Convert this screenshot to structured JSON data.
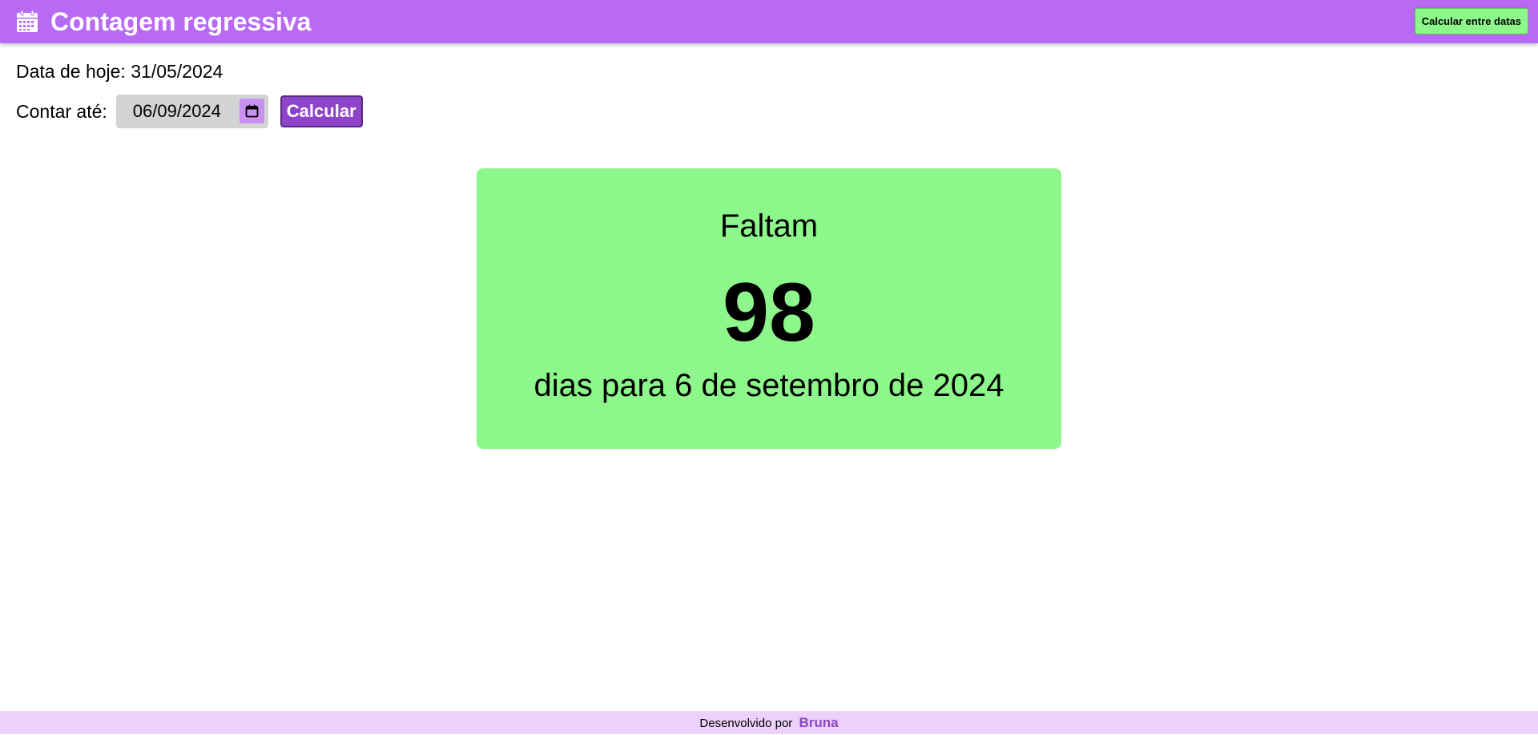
{
  "header": {
    "title": "Contagem regressiva",
    "icon": "calendar-icon",
    "between_dates_label": "Calcular entre datas"
  },
  "today": {
    "label": "Data de hoje:",
    "value": "31/05/2024"
  },
  "countdown": {
    "label": "Contar até:",
    "date_value": "06/09/2024",
    "picker_icon": "calendar-picker-icon",
    "calculate_label": "Calcular"
  },
  "result": {
    "prefix": "Faltam",
    "days": "98",
    "suffix": "dias para 6 de setembro de 2024"
  },
  "footer": {
    "text": "Desenvolvido por",
    "author": "Bruna"
  },
  "colors": {
    "header_bg": "#b86af5",
    "accent_green": "#8ef78b",
    "button_purple": "#8e44c8",
    "footer_bg": "#ecd1fb"
  }
}
